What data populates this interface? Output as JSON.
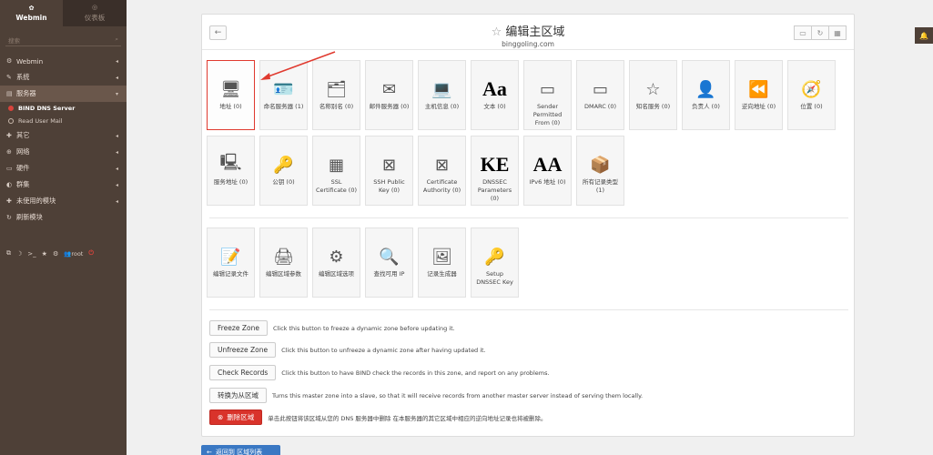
{
  "sidebar": {
    "webmin_tab": "Webmin",
    "dashboard_tab": "仪表板",
    "search_placeholder": "搜索",
    "items": [
      {
        "label": "Webmin",
        "icon": "gear-icon"
      },
      {
        "label": "系统",
        "icon": "wrench-icon"
      },
      {
        "label": "服务器",
        "icon": "server-icon"
      },
      {
        "label": "其它",
        "icon": "puzzle-icon"
      },
      {
        "label": "网络",
        "icon": "network-icon"
      },
      {
        "label": "硬件",
        "icon": "hdd-icon"
      },
      {
        "label": "群集",
        "icon": "cluster-icon"
      },
      {
        "label": "未使用的模块",
        "icon": "puzzle-icon"
      },
      {
        "label": "刷新模块",
        "icon": "refresh-icon"
      }
    ],
    "sub_items": [
      {
        "label": "BIND DNS Server"
      },
      {
        "label": "Read User Mail"
      }
    ],
    "user": "root"
  },
  "header": {
    "title": "编辑主区域",
    "subtitle": "binggoling.com"
  },
  "icons_row1": [
    {
      "label": "地址 (0)",
      "glyph": "🖥"
    },
    {
      "label": "命名服务器 (1)",
      "glyph": "🪪"
    },
    {
      "label": "名称别名 (0)",
      "glyph": "🗂"
    },
    {
      "label": "邮件服务器 (0)",
      "glyph": "✉"
    },
    {
      "label": "主机信息 (0)",
      "glyph": "💻"
    },
    {
      "label": "文本 (0)",
      "glyph": "Aa"
    },
    {
      "label": "Sender Permitted From (0)",
      "glyph": "▭"
    },
    {
      "label": "DMARC (0)",
      "glyph": "▭"
    },
    {
      "label": "知名服务 (0)",
      "glyph": "☆"
    },
    {
      "label": "负责人 (0)",
      "glyph": "👤"
    },
    {
      "label": "逆向地址 (0)",
      "glyph": "⏪"
    },
    {
      "label": "位置 (0)",
      "glyph": "🧭"
    }
  ],
  "icons_row2": [
    {
      "label": "服务地址 (0)",
      "glyph": "🖳"
    },
    {
      "label": "公钥 (0)",
      "glyph": "🔑"
    },
    {
      "label": "SSL Certificate (0)",
      "glyph": "▦"
    },
    {
      "label": "SSH Public Key (0)",
      "glyph": "⊠"
    },
    {
      "label": "Certificate Authority (0)",
      "glyph": "⊠"
    },
    {
      "label": "DNSSEC Parameters (0)",
      "glyph": "KE"
    },
    {
      "label": "IPv6 地址 (0)",
      "glyph": "AA"
    },
    {
      "label": "所有记录类型 (1)",
      "glyph": "📦"
    }
  ],
  "icons_row3": [
    {
      "label": "编辑记录文件",
      "glyph": "📝"
    },
    {
      "label": "编辑区域参数",
      "glyph": "🖨"
    },
    {
      "label": "编辑区域选项",
      "glyph": "⚙"
    },
    {
      "label": "查找可用 IP",
      "glyph": "🔍"
    },
    {
      "label": "记录生成器",
      "glyph": "🖼"
    },
    {
      "label": "Setup DNSSEC Key",
      "glyph": "🔑"
    }
  ],
  "actions": [
    {
      "button": "Freeze Zone",
      "desc": "Click this button to freeze a dynamic zone before updating it."
    },
    {
      "button": "Unfreeze Zone",
      "desc": "Click this button to unfreeze a dynamic zone after having updated it."
    },
    {
      "button": "Check Records",
      "desc": "Click this button to have BIND check the records in this zone, and report on any problems."
    },
    {
      "button": "转换为从区域",
      "desc": "Turns this master zone into a slave, so that it will receive records from another master server instead of serving them locally."
    },
    {
      "button": "删除区域",
      "desc": "单击此按钮将该区域从您的 DNS 服务器中删除 在本服务器的其它区域中相应的逆向地址记录也将被删除。"
    }
  ],
  "return_button": "返回到 区域列表",
  "colors": {
    "sidebar": "#4e4037",
    "danger": "#d9332b",
    "highlight": "#e03a2f",
    "primary": "#3a78c3"
  }
}
